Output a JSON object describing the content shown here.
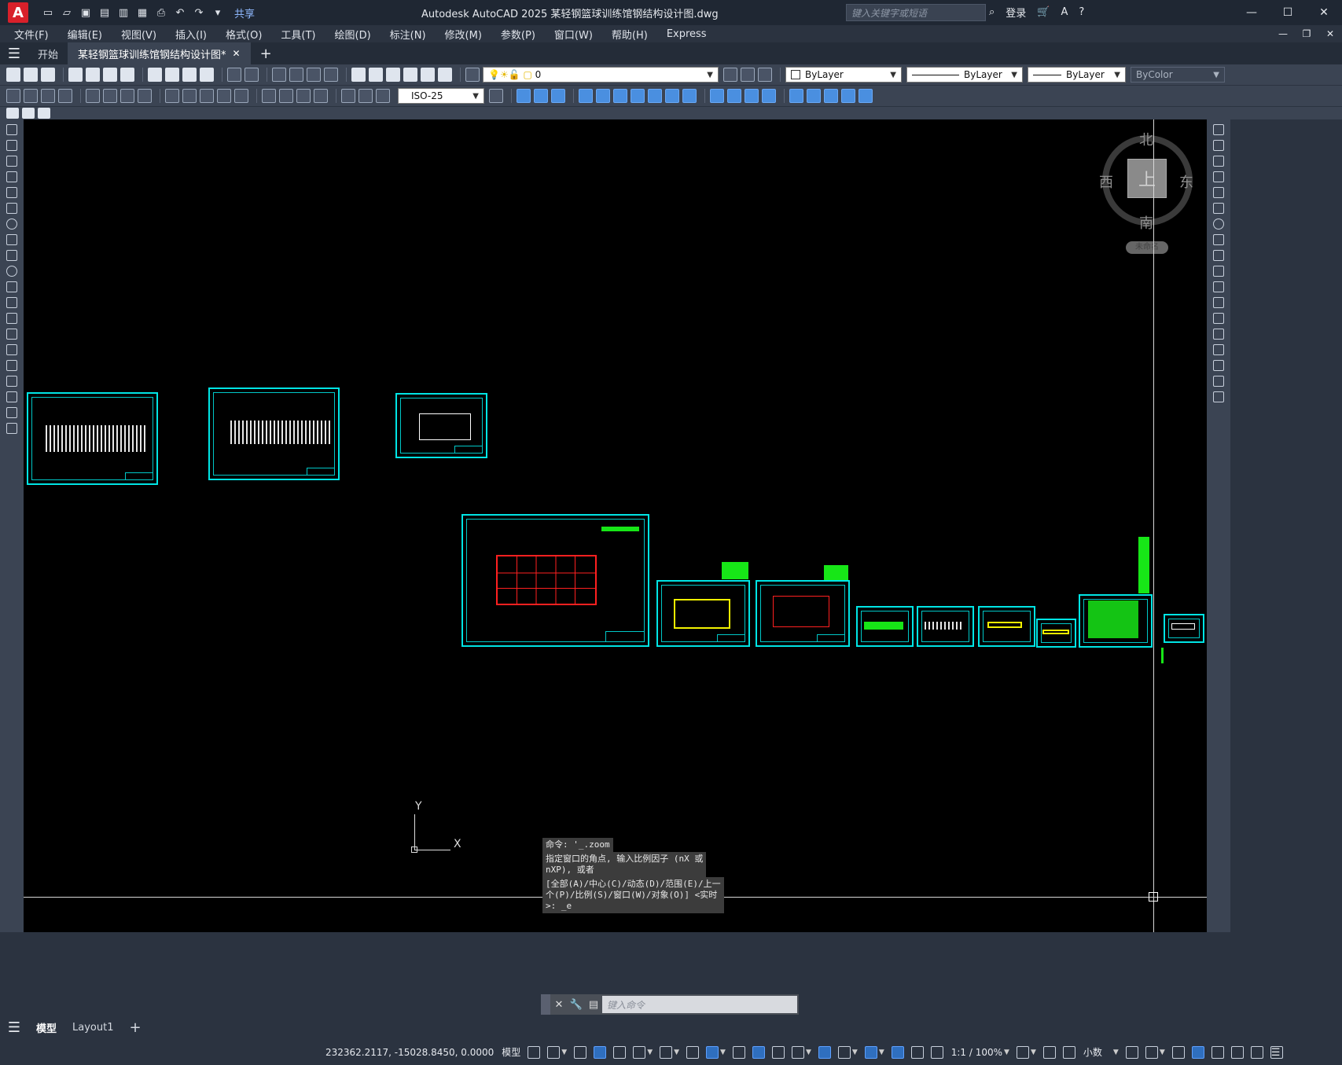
{
  "titlebar": {
    "app_letter": "A",
    "share": "共享",
    "title": "Autodesk AutoCAD 2025    某轻钢篮球训练馆钢结构设计图.dwg",
    "search_placeholder": "键入关键字或短语",
    "login": "登录"
  },
  "menu": [
    "文件(F)",
    "编辑(E)",
    "视图(V)",
    "插入(I)",
    "格式(O)",
    "工具(T)",
    "绘图(D)",
    "标注(N)",
    "修改(M)",
    "参数(P)",
    "窗口(W)",
    "帮助(H)",
    "Express"
  ],
  "tabs": {
    "start": "开始",
    "doc": "某轻钢篮球训练馆钢结构设计图*",
    "add": "+"
  },
  "toolbar": {
    "layer_value": "0",
    "color": "ByLayer",
    "linetype": "ByLayer",
    "lineweight": "ByLayer",
    "plotstyle": "ByColor",
    "dimstyle": "ISO-25"
  },
  "viewcube": {
    "top": "上",
    "north": "北",
    "south": "南",
    "west": "西",
    "east": "东",
    "wcs": "未命名"
  },
  "ucs": {
    "x": "X",
    "y": "Y"
  },
  "command": {
    "history": [
      "命令: '_.zoom",
      "指定窗口的角点, 输入比例因子 (nX 或\nnXP), 或者",
      "[全部(A)/中心(C)/动态(D)/范围(E)/上一\n个(P)/比例(S)/窗口(W)/对象(O)] <实时\n>: _e"
    ],
    "placeholder": "键入命令"
  },
  "layout_tabs": {
    "model": "模型",
    "layout1": "Layout1",
    "add": "+"
  },
  "statusbar": {
    "coords": "232362.2117, -15028.8450, 0.0000",
    "model": "模型",
    "scale": "1:1 / 100%",
    "units": "小数"
  },
  "colors": {
    "sheet_border": "#00e5e5",
    "grid_red": "#ff2020",
    "detail_green": "#17e617",
    "frame_yellow": "#f2f200",
    "canvas": "#000000",
    "chrome": "#3b4453"
  }
}
